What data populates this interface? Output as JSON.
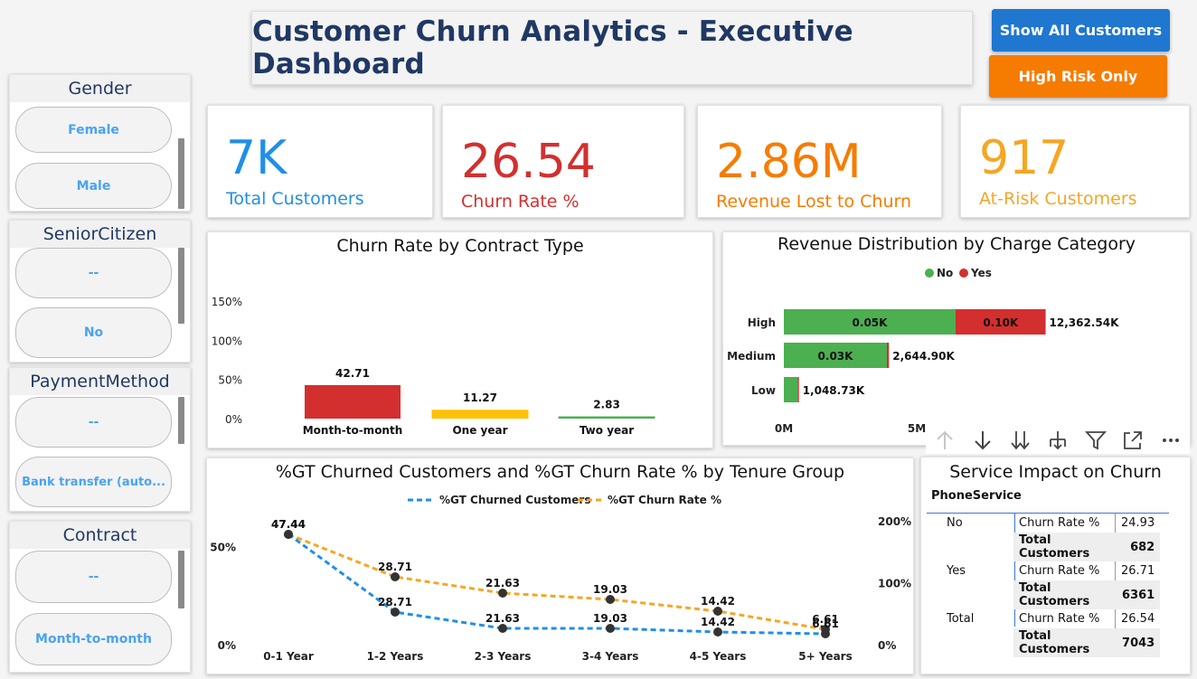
{
  "header": {
    "title": "Customer Churn Analytics - Executive Dashboard"
  },
  "buttons": {
    "show_all": {
      "label": "Show All Customers",
      "color": "#1f77d0"
    },
    "high_risk": {
      "label": "High Risk Only",
      "color": "#f57c00"
    }
  },
  "slicers": {
    "gender": {
      "title": "Gender",
      "items": [
        "Female",
        "Male"
      ]
    },
    "senior": {
      "title": "SeniorCitizen",
      "items": [
        "--",
        "No"
      ]
    },
    "payment": {
      "title": "PaymentMethod",
      "items": [
        "--",
        "Bank transfer (auto..."
      ]
    },
    "contract": {
      "title": "Contract",
      "items": [
        "--",
        "Month-to-month"
      ]
    }
  },
  "kpis": [
    {
      "value": "7K",
      "label": "Total Customers",
      "color": "#1f8fe8"
    },
    {
      "value": "26.54",
      "label": "Churn Rate %",
      "color": "#d32f2f"
    },
    {
      "value": "2.86M",
      "label": "Revenue Lost to Churn",
      "color": "#f57c00"
    },
    {
      "value": "917",
      "label": "At-Risk Customers",
      "color": "#f5a623"
    }
  ],
  "charts": {
    "contract": {
      "title": "Churn Rate by Contract Type"
    },
    "revenue": {
      "title": "Revenue Distribution by Charge Category"
    },
    "tenure": {
      "title": "%GT Churned Customers and %GT Churn Rate % by Tenure Group"
    },
    "service": {
      "title": "Service Impact on Churn"
    }
  },
  "chart_data": [
    {
      "type": "bar",
      "title": "Churn Rate by Contract Type",
      "categories": [
        "Month-to-month",
        "One year",
        "Two year"
      ],
      "values": [
        42.71,
        11.27,
        2.83
      ],
      "value_labels": [
        "42.71",
        "11.27",
        "2.83"
      ],
      "colors": [
        "#d32f2f",
        "#ffc107",
        "#4caf50"
      ],
      "y_ticks": [
        "0%",
        "50%",
        "100%",
        "150%"
      ],
      "y_tick_values": [
        0,
        50,
        100,
        150
      ]
    },
    {
      "type": "bar",
      "orientation": "horizontal",
      "stacked": true,
      "title": "Revenue Distribution by Charge Category",
      "legend": [
        {
          "name": "No",
          "color": "#4caf50"
        },
        {
          "name": "Yes",
          "color": "#d32f2f"
        }
      ],
      "legend_position": "top-center",
      "categories": [
        "High",
        "Medium",
        "Low"
      ],
      "series": [
        {
          "name": "No",
          "color": "#4caf50",
          "values": [
            0.05,
            0.03,
            0.004
          ],
          "labels": [
            "0.05K",
            "0.03K",
            ""
          ]
        },
        {
          "name": "Yes",
          "color": "#d32f2f",
          "values": [
            0.0262,
            0.0006,
            0.0001
          ],
          "labels": [
            "0.10K",
            "",
            ""
          ]
        }
      ],
      "totals": [
        "12,362.54K",
        "2,644.90K",
        "1,048.73K"
      ],
      "x_ticks": [
        "0M",
        "5M"
      ]
    },
    {
      "type": "line",
      "title": "%GT Churned Customers and %GT Churn Rate % by Tenure Group",
      "categories": [
        "0-1 Year",
        "1-2 Years",
        "2-3 Years",
        "3-4 Years",
        "4-5 Years",
        "5+ Years"
      ],
      "legend_position": "top-center",
      "series": [
        {
          "name": "%GT Churned Customers",
          "color": "#1f8fe8",
          "axis": "left",
          "values": [
            47.44,
            28.71,
            21.63,
            19.03,
            14.42,
            6.61
          ],
          "labels": [
            "47.44",
            "28.71",
            "21.63",
            "19.03",
            "14.42",
            "6.61"
          ]
        },
        {
          "name": "%GT Churn Rate %",
          "color": "#f5a623",
          "axis": "right",
          "values": [
            47.44,
            28.71,
            21.63,
            19.03,
            14.42,
            6.61
          ],
          "labels": [
            "47.44",
            "28.71",
            "21.63",
            "19.03",
            "14.42",
            "6.61"
          ]
        }
      ],
      "y_left_ticks": [
        "0%",
        "50%"
      ],
      "y_left_values": [
        0,
        50
      ],
      "y_left_max": 60,
      "y_right_ticks": [
        "0%",
        "100%",
        "200%"
      ],
      "y_right_values": [
        0,
        100,
        200
      ],
      "y_right_max": 240
    },
    {
      "type": "table",
      "title": "Service Impact on Churn",
      "row_header": "PhoneService",
      "rows": [
        {
          "group": "No",
          "measures": [
            [
              "Churn Rate %",
              "24.93"
            ],
            [
              "Total Customers",
              "682"
            ]
          ]
        },
        {
          "group": "Yes",
          "measures": [
            [
              "Churn Rate %",
              "26.71"
            ],
            [
              "Total Customers",
              "6361"
            ]
          ]
        },
        {
          "group": "Total",
          "measures": [
            [
              "Churn Rate %",
              "26.54"
            ],
            [
              "Total Customers",
              "7043"
            ]
          ]
        }
      ]
    }
  ],
  "toolbar_icons": [
    "arrow-up-icon",
    "arrow-down-icon",
    "double-arrow-down-icon",
    "expand-hierarchy-icon",
    "filter-icon",
    "focus-mode-icon",
    "more-options-icon"
  ]
}
